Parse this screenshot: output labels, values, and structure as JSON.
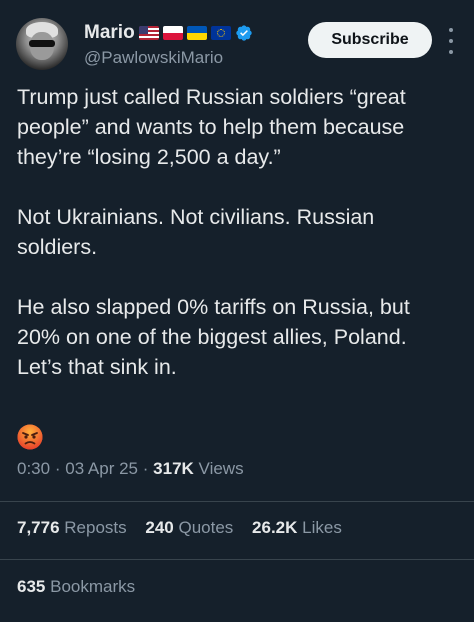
{
  "author": {
    "display_name": "Mario",
    "handle": "@PawlowskiMario",
    "badges": [
      "us-flag-icon",
      "poland-flag-icon",
      "ukraine-flag-icon",
      "eu-flag-icon",
      "verified-badge-icon"
    ],
    "verified_color": "#1d9bf0"
  },
  "header": {
    "subscribe_label": "Subscribe"
  },
  "tweet": {
    "paragraphs": [
      "Trump just called Russian soldiers “great people” and wants to help them because they’re “losing 2,500 a day.”",
      "Not Ukrainians. Not civilians. Russian soldiers.",
      "He also slapped 0% tariffs on Russia, but 20% on one of the biggest allies, Poland. Let’s that sink in."
    ],
    "emoji": "angry-face-emoji"
  },
  "meta": {
    "time": "0:30",
    "separator": "·",
    "date": "03 Apr 25",
    "views_count": "317K",
    "views_label": "Views"
  },
  "stats": {
    "reposts_count": "7,776",
    "reposts_label": "Reposts",
    "quotes_count": "240",
    "quotes_label": "Quotes",
    "likes_count": "26.2K",
    "likes_label": "Likes",
    "bookmarks_count": "635",
    "bookmarks_label": "Bookmarks"
  },
  "colors": {
    "background": "#15202b",
    "text": "#e7e9ea",
    "muted": "#8b98a5",
    "divider": "#38444d",
    "button_bg": "#eff3f4"
  }
}
